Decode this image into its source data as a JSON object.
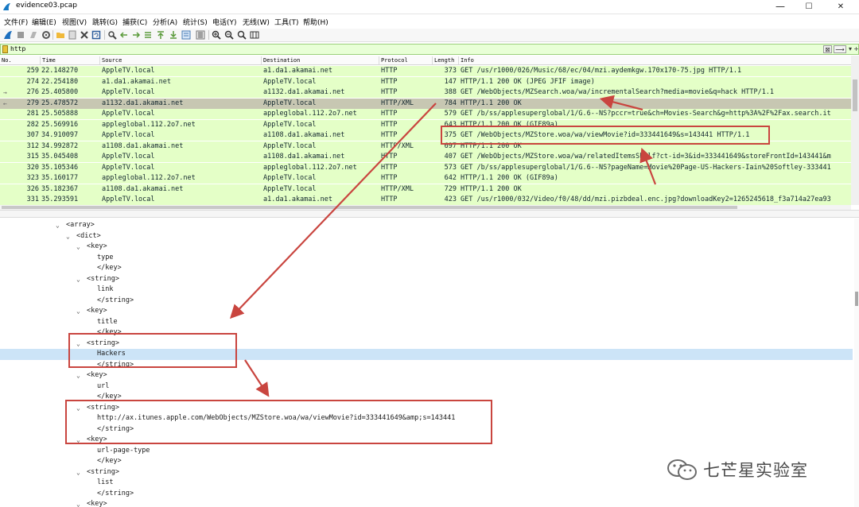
{
  "window": {
    "title": "evidence03.pcap",
    "minimize": "—",
    "maximize": "☐",
    "close": "✕"
  },
  "menu": [
    "文件(F)",
    "编辑(E)",
    "视图(V)",
    "跳转(G)",
    "捕获(C)",
    "分析(A)",
    "统计(S)",
    "电话(Y)",
    "无线(W)",
    "工具(T)",
    "帮助(H)"
  ],
  "toolbar_icons": [
    "shark-fin-start-icon",
    "stop-icon",
    "restart-icon",
    "options-gear-icon",
    "open-folder-icon",
    "save-file-icon",
    "close-file-icon",
    "reload-icon",
    "find-icon",
    "back-icon",
    "forward-icon",
    "goto-packet-icon",
    "first-packet-icon",
    "last-packet-icon",
    "autoscroll-icon",
    "colorize-icon",
    "zoom-in-icon",
    "zoom-out-icon",
    "zoom-reset-icon",
    "resize-columns-icon"
  ],
  "filter": {
    "value": "http",
    "clear": "⊠",
    "apply": "⟶",
    "dropdown": "▾",
    "add": "+"
  },
  "packet_list": {
    "columns": [
      "No.",
      "Time",
      "Source",
      "Destination",
      "Protocol",
      "Length",
      "Info"
    ],
    "rows": [
      {
        "no": "259",
        "time": "22.148270",
        "src": "AppleTV.local",
        "dst": "a1.da1.akamai.net",
        "proto": "HTTP",
        "len": "373",
        "info": "GET /us/r1000/026/Music/68/ec/04/mzi.aydemkgw.170x170-75.jpg HTTP/1.1",
        "rel": "",
        "selected": false
      },
      {
        "no": "274",
        "time": "22.254180",
        "src": "a1.da1.akamai.net",
        "dst": "AppleTV.local",
        "proto": "HTTP",
        "len": "147",
        "info": "HTTP/1.1 200 OK  (JPEG JFIF image)",
        "rel": "",
        "selected": false
      },
      {
        "no": "276",
        "time": "25.405800",
        "src": "AppleTV.local",
        "dst": "a1132.da1.akamai.net",
        "proto": "HTTP",
        "len": "388",
        "info": "GET /WebObjects/MZSearch.woa/wa/incrementalSearch?media=movie&q=hack HTTP/1.1",
        "rel": "→",
        "selected": false
      },
      {
        "no": "279",
        "time": "25.478572",
        "src": "a1132.da1.akamai.net",
        "dst": "AppleTV.local",
        "proto": "HTTP/XML",
        "len": "784",
        "info": "HTTP/1.1 200 OK",
        "rel": "←",
        "selected": true
      },
      {
        "no": "281",
        "time": "25.505888",
        "src": "AppleTV.local",
        "dst": "appleglobal.112.2o7.net",
        "proto": "HTTP",
        "len": "579",
        "info": "GET /b/ss/applesuperglobal/1/G.6--NS?pccr=true&ch=Movies-Search&g=http%3A%2F%2Fax.search.it",
        "rel": "",
        "selected": false
      },
      {
        "no": "282",
        "time": "25.569916",
        "src": "appleglobal.112.2o7.net",
        "dst": "AppleTV.local",
        "proto": "HTTP",
        "len": "643",
        "info": "HTTP/1.1 200 OK  (GIF89a)",
        "rel": "",
        "selected": false
      },
      {
        "no": "307",
        "time": "34.910097",
        "src": "AppleTV.local",
        "dst": "a1108.da1.akamai.net",
        "proto": "HTTP",
        "len": "375",
        "info": "GET /WebObjects/MZStore.woa/wa/viewMovie?id=333441649&s=143441 HTTP/1.1",
        "rel": "",
        "selected": false
      },
      {
        "no": "312",
        "time": "34.992872",
        "src": "a1108.da1.akamai.net",
        "dst": "AppleTV.local",
        "proto": "HTTP/XML",
        "len": "697",
        "info": "HTTP/1.1 200 OK",
        "rel": "",
        "selected": false
      },
      {
        "no": "315",
        "time": "35.045408",
        "src": "AppleTV.local",
        "dst": "a1108.da1.akamai.net",
        "proto": "HTTP",
        "len": "407",
        "info": "GET /WebObjects/MZStore.woa/wa/relatedItemsShelf?ct-id=3&id=333441649&storeFrontId=143441&m",
        "rel": "",
        "selected": false
      },
      {
        "no": "320",
        "time": "35.105346",
        "src": "AppleTV.local",
        "dst": "appleglobal.112.2o7.net",
        "proto": "HTTP",
        "len": "573",
        "info": "GET /b/ss/applesuperglobal/1/G.6--NS?pageName=Movie%20Page-US-Hackers-Iain%20Softley-333441",
        "rel": "",
        "selected": false
      },
      {
        "no": "323",
        "time": "35.160177",
        "src": "appleglobal.112.2o7.net",
        "dst": "AppleTV.local",
        "proto": "HTTP",
        "len": "642",
        "info": "HTTP/1.1 200 OK  (GIF89a)",
        "rel": "",
        "selected": false
      },
      {
        "no": "326",
        "time": "35.182367",
        "src": "a1108.da1.akamai.net",
        "dst": "AppleTV.local",
        "proto": "HTTP/XML",
        "len": "729",
        "info": "HTTP/1.1 200 OK",
        "rel": "",
        "selected": false
      },
      {
        "no": "331",
        "time": "35.293591",
        "src": "AppleTV.local",
        "dst": "a1.da1.akamai.net",
        "proto": "HTTP",
        "len": "423",
        "info": "GET /us/r1000/032/Video/f0/48/dd/mzi.pizbdeal.enc.jpg?downloadKey2=1265245618_f3a714a27ea93",
        "rel": "",
        "selected": false
      }
    ]
  },
  "xml_tree": [
    {
      "depth": 0,
      "arrow": "v",
      "text": "<array>",
      "selected": false
    },
    {
      "depth": 1,
      "arrow": "v",
      "text": "<dict>",
      "selected": false
    },
    {
      "depth": 2,
      "arrow": "v",
      "text": "<key>",
      "selected": false
    },
    {
      "depth": 3,
      "arrow": "",
      "text": "type",
      "selected": false
    },
    {
      "depth": 3,
      "arrow": "",
      "text": "</key>",
      "selected": false
    },
    {
      "depth": 2,
      "arrow": "v",
      "text": "<string>",
      "selected": false
    },
    {
      "depth": 3,
      "arrow": "",
      "text": "link",
      "selected": false
    },
    {
      "depth": 3,
      "arrow": "",
      "text": "</string>",
      "selected": false
    },
    {
      "depth": 2,
      "arrow": "v",
      "text": "<key>",
      "selected": false
    },
    {
      "depth": 3,
      "arrow": "",
      "text": "title",
      "selected": false
    },
    {
      "depth": 3,
      "arrow": "",
      "text": "</key>",
      "selected": false
    },
    {
      "depth": 2,
      "arrow": "v",
      "text": "<string>",
      "selected": false
    },
    {
      "depth": 3,
      "arrow": "",
      "text": "Hackers",
      "selected": true
    },
    {
      "depth": 3,
      "arrow": "",
      "text": "</string>",
      "selected": false
    },
    {
      "depth": 2,
      "arrow": "v",
      "text": "<key>",
      "selected": false
    },
    {
      "depth": 3,
      "arrow": "",
      "text": "url",
      "selected": false
    },
    {
      "depth": 3,
      "arrow": "",
      "text": "</key>",
      "selected": false
    },
    {
      "depth": 2,
      "arrow": "v",
      "text": "<string>",
      "selected": false
    },
    {
      "depth": 3,
      "arrow": "",
      "text": "http://ax.itunes.apple.com/WebObjects/MZStore.woa/wa/viewMovie?id=333441649&amp;s=143441",
      "selected": false
    },
    {
      "depth": 3,
      "arrow": "",
      "text": "</string>",
      "selected": false
    },
    {
      "depth": 2,
      "arrow": "v",
      "text": "<key>",
      "selected": false
    },
    {
      "depth": 3,
      "arrow": "",
      "text": "url-page-type",
      "selected": false
    },
    {
      "depth": 3,
      "arrow": "",
      "text": "</key>",
      "selected": false
    },
    {
      "depth": 2,
      "arrow": "v",
      "text": "<string>",
      "selected": false
    },
    {
      "depth": 3,
      "arrow": "",
      "text": "list",
      "selected": false
    },
    {
      "depth": 3,
      "arrow": "",
      "text": "</string>",
      "selected": false
    },
    {
      "depth": 2,
      "arrow": "v",
      "text": "<key>",
      "selected": false
    }
  ],
  "watermark": {
    "text": "七芒星实验室"
  },
  "colors": {
    "annotation": "#c9453f",
    "row_bg": "#e4ffc7",
    "row_selected": "#c7c7b2",
    "tree_selected": "#cce4f7",
    "filter_bg": "#e8ffd6"
  }
}
